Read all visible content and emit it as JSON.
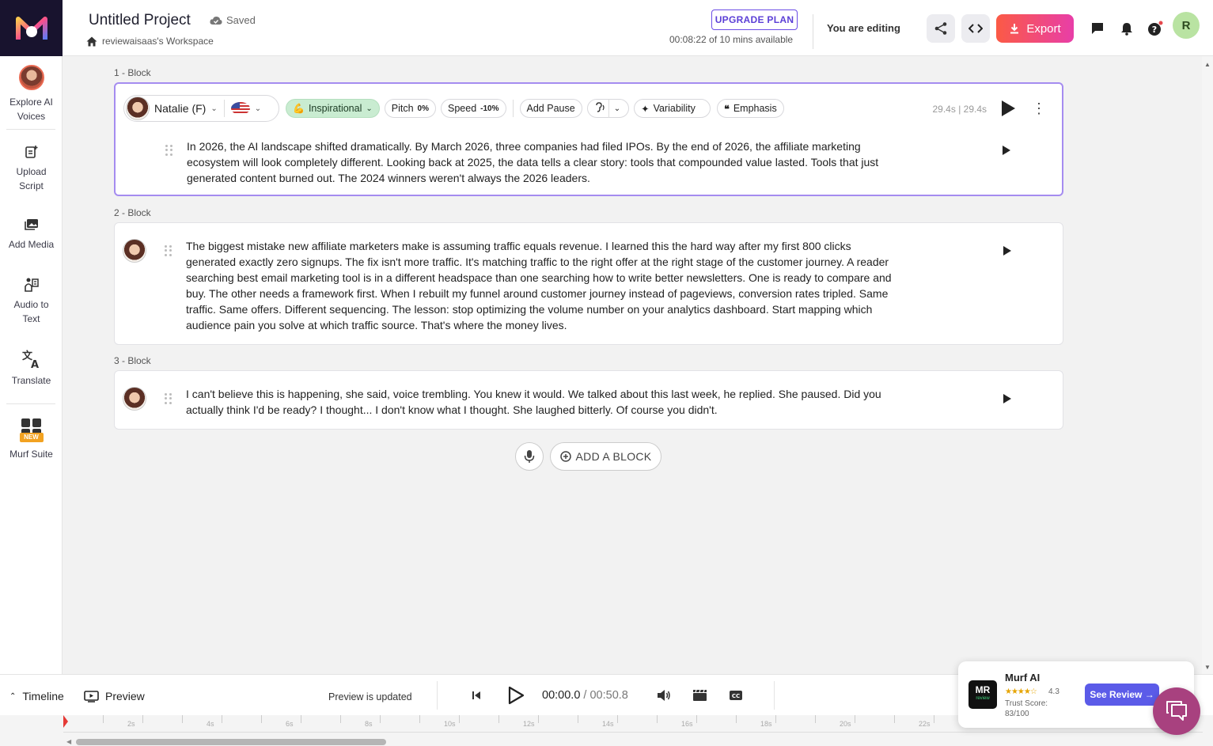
{
  "sidebar": {
    "items": [
      {
        "label_1": "Explore AI",
        "label_2": "Voices"
      },
      {
        "label_1": "Upload",
        "label_2": "Script"
      },
      {
        "label_1": "Add Media",
        "label_2": ""
      },
      {
        "label_1": "Audio to",
        "label_2": "Text"
      },
      {
        "label_1": "Translate",
        "label_2": ""
      },
      {
        "label_1": "Murf Suite",
        "label_2": "",
        "badge": "NEW"
      }
    ]
  },
  "header": {
    "project_title": "Untitled Project",
    "saved_label": "Saved",
    "workspace": "reviewaisaas's Workspace",
    "upgrade_label": "UPGRADE PLAN",
    "minutes_available": "00:08:22 of 10 mins available",
    "editing_label": "You are editing",
    "export_label": "Export",
    "user_initial": "R"
  },
  "blocks": [
    {
      "label": "1 -  Block",
      "voice_name": "Natalie (F)",
      "style": "Inspirational",
      "pitch_label": "Pitch",
      "pitch_value": "0%",
      "speed_label": "Speed",
      "speed_value": "-10%",
      "add_pause": "Add Pause",
      "variability": "Variability",
      "emphasis": "Emphasis",
      "duration": "29.4s | 29.4s",
      "text": "In 2026, the AI landscape shifted dramatically. By March 2026, three companies had filed IPOs. By the end of 2026, the affiliate marketing ecosystem will look completely different. Looking back at 2025, the data tells a clear story: tools that compounded value lasted. Tools that just generated content burned out. The 2024 winners weren't always the 2026 leaders."
    },
    {
      "label": "2 -  Block",
      "text": "The biggest mistake new affiliate marketers make is assuming traffic equals revenue. I learned this the hard way after my first 800 clicks generated exactly zero signups. The fix isn't more traffic. It's matching traffic to the right offer at the right stage of the customer journey. A reader searching best email marketing tool is in a different headspace than one searching how to write better newsletters. One is ready to compare and buy. The other needs a framework first. When I rebuilt my funnel around customer journey instead of pageviews, conversion rates tripled. Same traffic. Same offers. Different sequencing. The lesson: stop optimizing the volume number on your analytics dashboard. Start mapping which audience pain you solve at which traffic source. That's where the money lives."
    },
    {
      "label": "3 -  Block",
      "text": "I can't believe this is happening, she said, voice trembling. You knew it would. We talked about this last week, he replied. She paused. Did you actually think I'd be ready? I thought... I don't know what I thought. She laughed bitterly. Of course you didn't."
    }
  ],
  "add_block_label": "ADD A BLOCK",
  "bottombar": {
    "timeline_label": "Timeline",
    "preview_label": "Preview",
    "status": "Preview is updated",
    "current_time": "00:00.0",
    "separator": " / ",
    "total_time": "00:50.8"
  },
  "timeline": {
    "ticks": [
      "2s",
      "4s",
      "6s",
      "8s",
      "10s",
      "12s",
      "14s",
      "16s",
      "18s",
      "20s",
      "22s"
    ]
  },
  "review_widget": {
    "logo_text": "MR",
    "logo_sub": "review",
    "name": "Murf AI",
    "stars": "★★★★☆",
    "rating": "4.3",
    "trust_label": "Trust Score:",
    "trust_value": "83/100",
    "button": "See Review →"
  },
  "colors": {
    "accent": "#6b4ce6",
    "export_gradient_start": "#fb5a45",
    "export_gradient_end": "#e83ea8",
    "active_border": "#a58cf0",
    "style_chip": "#c9ecd1"
  }
}
